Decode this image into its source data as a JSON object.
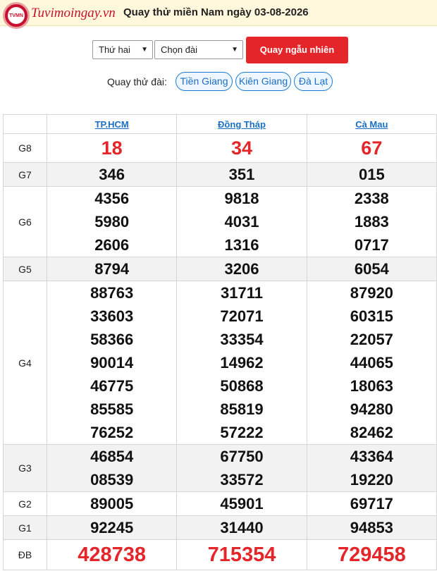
{
  "header": {
    "logo_text": "TVMN",
    "brand": "Tuvimoingay.vn",
    "title": "Quay thử miền Nam ngày 03-08-2026"
  },
  "controls": {
    "day_select_value": "Thứ hai",
    "station_select_value": "Chọn đài",
    "random_button_label": "Quay ngẫu nhiên"
  },
  "quick": {
    "label": "Quay thử đài:",
    "stations": [
      "Tiền Giang",
      "Kiên Giang",
      "Đà Lạt"
    ]
  },
  "table": {
    "columns": [
      "TP.HCM",
      "Đồng Tháp",
      "Cà Mau"
    ],
    "prizes": [
      {
        "label": "G8",
        "values": [
          [
            "18"
          ],
          [
            "34"
          ],
          [
            "67"
          ]
        ]
      },
      {
        "label": "G7",
        "values": [
          [
            "346"
          ],
          [
            "351"
          ],
          [
            "015"
          ]
        ]
      },
      {
        "label": "G6",
        "values": [
          [
            "4356",
            "5980",
            "2606"
          ],
          [
            "9818",
            "4031",
            "1316"
          ],
          [
            "2338",
            "1883",
            "0717"
          ]
        ]
      },
      {
        "label": "G5",
        "values": [
          [
            "8794"
          ],
          [
            "3206"
          ],
          [
            "6054"
          ]
        ]
      },
      {
        "label": "G4",
        "values": [
          [
            "88763",
            "33603",
            "58366",
            "90014",
            "46775",
            "85585",
            "76252"
          ],
          [
            "31711",
            "72071",
            "33354",
            "14962",
            "50868",
            "85819",
            "57222"
          ],
          [
            "87920",
            "60315",
            "22057",
            "44065",
            "18063",
            "94280",
            "82462"
          ]
        ]
      },
      {
        "label": "G3",
        "values": [
          [
            "46854",
            "08539"
          ],
          [
            "67750",
            "33572"
          ],
          [
            "43364",
            "19220"
          ]
        ]
      },
      {
        "label": "G2",
        "values": [
          [
            "89005"
          ],
          [
            "45901"
          ],
          [
            "69717"
          ]
        ]
      },
      {
        "label": "G1",
        "values": [
          [
            "92245"
          ],
          [
            "31440"
          ],
          [
            "94853"
          ]
        ]
      },
      {
        "label": "ĐB",
        "values": [
          [
            "428738"
          ],
          [
            "715354"
          ],
          [
            "729458"
          ]
        ]
      }
    ]
  }
}
